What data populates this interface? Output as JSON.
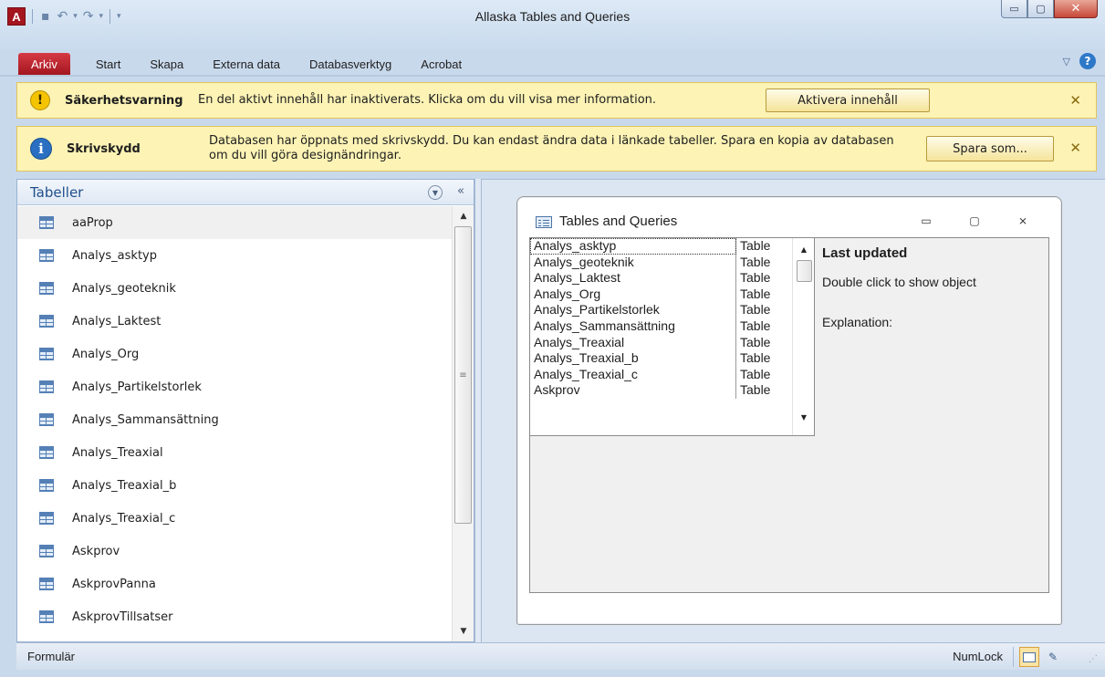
{
  "window": {
    "title": "Allaska Tables and Queries",
    "app_icon_letter": "A",
    "min_glyph": "▭",
    "max_glyph": "▢",
    "close_glyph": "✕"
  },
  "qat": {
    "save_icon": "floppy-icon",
    "undo_glyph": "↶",
    "redo_glyph": "↷",
    "dropdown_glyph": "▾",
    "customize_glyph": "▾"
  },
  "ribbon": {
    "tabs": [
      "Arkiv",
      "Start",
      "Skapa",
      "Externa data",
      "Databasverktyg",
      "Acrobat"
    ],
    "expand_glyph": "▽",
    "help_glyph": "?"
  },
  "security_bar": {
    "icon_glyph": "!",
    "title": "Säkerhetsvarning",
    "text": "En del aktivt innehåll har inaktiverats. Klicka om du vill visa mer information.",
    "button": "Aktivera innehåll",
    "close_glyph": "✕"
  },
  "readonly_bar": {
    "icon_glyph": "i",
    "title": "Skrivskydd",
    "text": "Databasen har öppnats med skrivskydd. Du kan endast ändra data i länkade tabeller. Spara en kopia av databasen om du vill göra designändringar.",
    "button": "Spara som...",
    "close_glyph": "✕"
  },
  "nav": {
    "title": "Tabeller",
    "dropdown_glyph": "▼",
    "collapse_glyph": "«",
    "items": [
      "aaProp",
      "Analys_asktyp",
      "Analys_geoteknik",
      "Analys_Laktest",
      "Analys_Org",
      "Analys_Partikelstorlek",
      "Analys_Sammansättning",
      "Analys_Treaxial",
      "Analys_Treaxial_b",
      "Analys_Treaxial_c",
      "Askprov",
      "AskprovPanna",
      "AskprovTillsatser"
    ],
    "scroll_up_glyph": "▲",
    "scroll_down_glyph": "▼",
    "thumb_glyph": "≡"
  },
  "form": {
    "title": "Tables and Queries",
    "min_glyph": "▭",
    "max_glyph": "▢",
    "close_glyph": "⨯",
    "rows": [
      {
        "name": "Analys_asktyp",
        "type": "Table"
      },
      {
        "name": "Analys_geoteknik",
        "type": "Table"
      },
      {
        "name": "Analys_Laktest",
        "type": "Table"
      },
      {
        "name": "Analys_Org",
        "type": "Table"
      },
      {
        "name": "Analys_Partikelstorlek",
        "type": "Table"
      },
      {
        "name": "Analys_Sammansättning",
        "type": "Table"
      },
      {
        "name": "Analys_Treaxial",
        "type": "Table"
      },
      {
        "name": "Analys_Treaxial_b",
        "type": "Table"
      },
      {
        "name": "Analys_Treaxial_c",
        "type": "Table"
      },
      {
        "name": "Askprov",
        "type": "Table"
      }
    ],
    "scroll_up_glyph": "▲",
    "scroll_down_glyph": "▼",
    "last_updated": "Last updated",
    "double_click_hint": "Double click to show object",
    "explanation_label": "Explanation:"
  },
  "status": {
    "left": "Formulär",
    "numlock": "NumLock",
    "design_view_glyph": "✎",
    "grip_glyph": "⋰"
  },
  "colors": {
    "file_tab": "#a3161f",
    "message_bar": "#fcf3b5",
    "nav_title": "#1f4f8a"
  }
}
